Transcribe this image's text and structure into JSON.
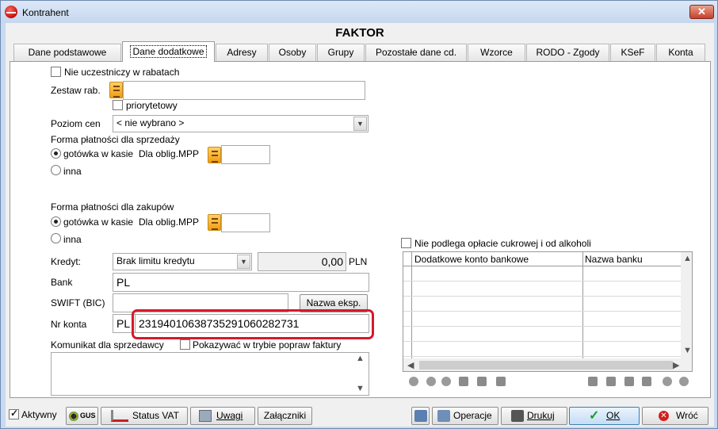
{
  "window": {
    "title": "Kontrahent",
    "close_glyph": "✕"
  },
  "firm_name": "FAKTOR",
  "tabs": [
    {
      "label": "Dane podstawowe"
    },
    {
      "label": "Dane dodatkowe"
    },
    {
      "label": "Adresy"
    },
    {
      "label": "Osoby"
    },
    {
      "label": "Grupy"
    },
    {
      "label": "Pozostałe dane cd."
    },
    {
      "label": "Wzorce"
    },
    {
      "label": "RODO - Zgody"
    },
    {
      "label": "KSeF"
    },
    {
      "label": "Konta"
    }
  ],
  "form": {
    "no_discount_label": "Nie uczestniczy w rabatach",
    "discount_set_label": "Zestaw rab.",
    "discount_set_value": "",
    "priority_label": "priorytetowy",
    "price_level_label": "Poziom cen",
    "price_level_value": "< nie wybrano >",
    "sales_payment_label": "Forma płatności dla sprzedaży",
    "cash_label": "gotówka w kasie",
    "mpp_label": "Dla oblig.MPP",
    "other_label": "inna",
    "purchase_payment_label": "Forma płatności dla zakupów",
    "credit_label": "Kredyt:",
    "credit_value": "Brak limitu kredytu",
    "credit_amount": "0,00",
    "currency": "PLN",
    "bank_label": "Bank",
    "bank_value": "PL",
    "swift_label": "SWIFT (BIC)",
    "swift_value": "",
    "foreign_name_button": "Nazwa eksp.",
    "account_label": "Nr konta",
    "account_prefix": "PL",
    "account_number": "23194010638735291060282731",
    "seller_message_label": "Komunikat dla sprzedawcy",
    "show_in_correction_label": "Pokazywać w trybie popraw faktury",
    "seller_message_value": "",
    "sugar_alcohol_label": "Nie podlega opłacie cukrowej i od alkoholi"
  },
  "accounts_table": {
    "columns": [
      "Dodatkowe konto bankowe",
      "Nazwa banku"
    ],
    "rows": []
  },
  "footer": {
    "active_label": "Aktywny",
    "gus_label": "GUS",
    "vat_status_label": "Status VAT",
    "notes_label": "Uwagi",
    "attachments_label": "Załączniki",
    "operations_label": "Operacje",
    "print_label": "Drukuj",
    "ok_label": "OK",
    "back_label": "Wróć"
  },
  "colors": {
    "highlight": "#d5192a",
    "title_bar": "#c9daf0",
    "ok_check": "#1a9b2d",
    "back_icon": "#d22020"
  }
}
